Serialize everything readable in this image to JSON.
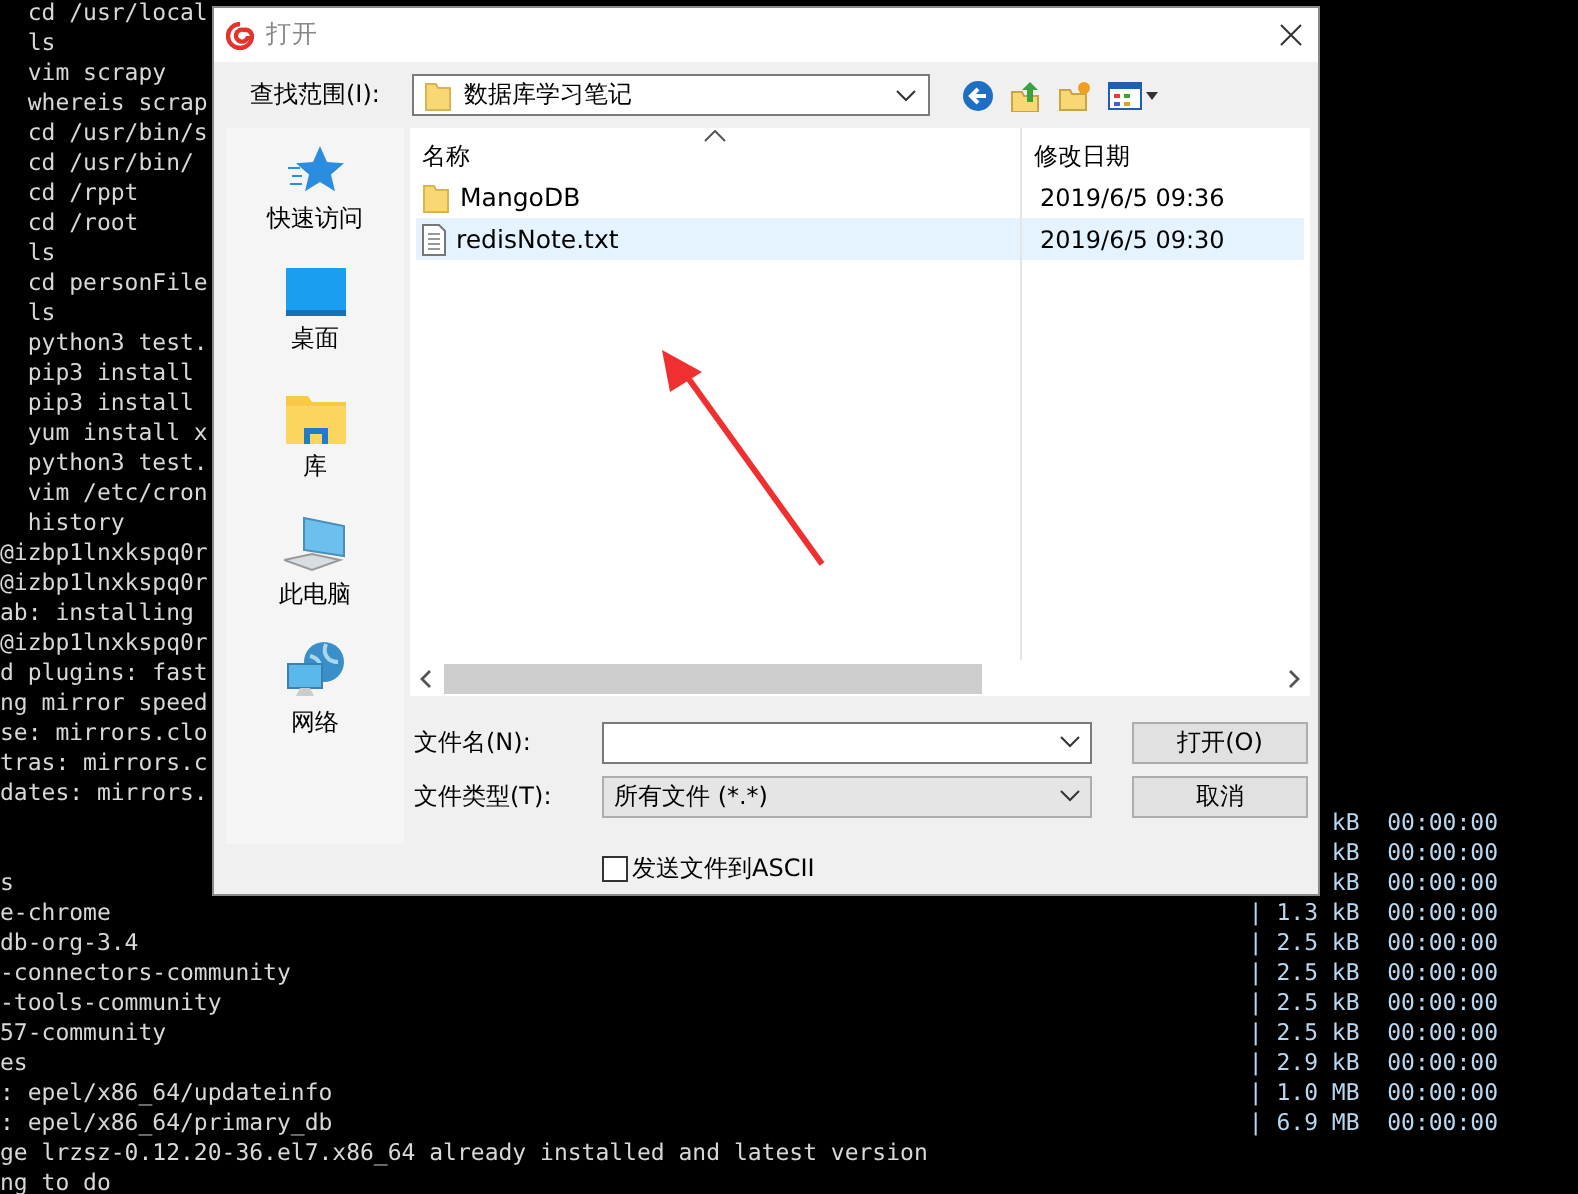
{
  "terminal": {
    "lines": [
      {
        "left": "  cd /usr/local"
      },
      {
        "left": "  ls"
      },
      {
        "left": "  vim scrapy"
      },
      {
        "left": "  whereis scrap"
      },
      {
        "left": "  cd /usr/bin/s"
      },
      {
        "left": "  cd /usr/bin/"
      },
      {
        "left": "  cd /rppt"
      },
      {
        "left": "  cd /root"
      },
      {
        "left": "  ls"
      },
      {
        "left": "  cd personFile"
      },
      {
        "left": "  ls"
      },
      {
        "left": "  python3 test."
      },
      {
        "left": "  pip3 install"
      },
      {
        "left": "  pip3 install"
      },
      {
        "left": "  yum install x"
      },
      {
        "left": "  python3 test."
      },
      {
        "left": "  vim /etc/cron"
      },
      {
        "left": "  history"
      },
      {
        "left": "@izbp1lnxkspq0r"
      },
      {
        "left": "@izbp1lnxkspq0r"
      },
      {
        "left": "ab: installing"
      },
      {
        "left": "@izbp1lnxkspq0r"
      },
      {
        "left": "d plugins: fast"
      },
      {
        "left": "ng mirror speed"
      },
      {
        "left": "se: mirrors.clo"
      },
      {
        "left": "tras: mirrors.c"
      },
      {
        "left": "dates: mirrors."
      },
      {
        "right": "kB  00:00:00"
      },
      {
        "right": "kB  00:00:00"
      },
      {
        "left": "s",
        "right": "kB  00:00:00"
      },
      {
        "left": "e-chrome",
        "right": "| 1.3 kB  00:00:00"
      },
      {
        "left": "db-org-3.4",
        "right": "| 2.5 kB  00:00:00"
      },
      {
        "left": "-connectors-community",
        "right": "| 2.5 kB  00:00:00"
      },
      {
        "left": "-tools-community",
        "right": "| 2.5 kB  00:00:00"
      },
      {
        "left": "57-community",
        "right": "| 2.5 kB  00:00:00"
      },
      {
        "left": "es",
        "right": "| 2.9 kB  00:00:00"
      },
      {
        "left": ": epel/x86_64/updateinfo",
        "right": "| 1.0 MB  00:00:00"
      },
      {
        "left": ": epel/x86_64/primary_db",
        "right": "| 6.9 MB  00:00:00"
      },
      {
        "left": "ge lrzsz-0.12.20-36.el7.x86_64 already installed and latest version"
      },
      {
        "left": "ng to do"
      }
    ]
  },
  "dialog": {
    "title": "打开",
    "look_in_label": "查找范围(I):",
    "look_in_value": "数据库学习笔记",
    "places": [
      {
        "label": "快速访问",
        "kind": "star"
      },
      {
        "label": "桌面",
        "kind": "desktop"
      },
      {
        "label": "库",
        "kind": "library"
      },
      {
        "label": "此电脑",
        "kind": "computer"
      },
      {
        "label": "网络",
        "kind": "network"
      }
    ],
    "columns": [
      "名称",
      "修改日期"
    ],
    "files": [
      {
        "name": "MangoDB",
        "kind": "folder",
        "modified": "2019/6/5 09:36",
        "selected": false
      },
      {
        "name": "redisNote.txt",
        "kind": "file",
        "modified": "2019/6/5 09:30",
        "selected": true
      }
    ],
    "filename_label": "文件名(N):",
    "filetype_label": "文件类型(T):",
    "filetype_value": "所有文件 (*.*)",
    "buttons": [
      "打开(O)",
      "取消"
    ],
    "checkbox": {
      "label": "发送文件到ASCII",
      "checked": false
    }
  }
}
